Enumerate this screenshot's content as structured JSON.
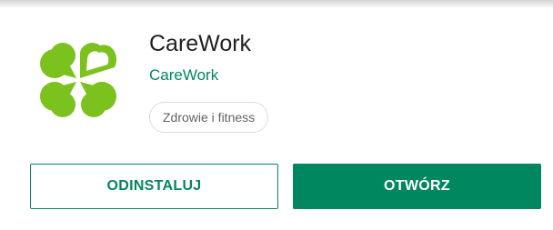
{
  "app": {
    "title": "CareWork",
    "developer": "CareWork",
    "category": "Zdrowie i fitness",
    "icon": "clover-heart-icon"
  },
  "actions": {
    "uninstall_label": "ODINSTALUJ",
    "open_label": "OTWÓRZ"
  },
  "colors": {
    "accent": "#01875f",
    "icon_green": "#7bc21f",
    "title_text": "#212121",
    "chip_border": "#dadce0"
  }
}
